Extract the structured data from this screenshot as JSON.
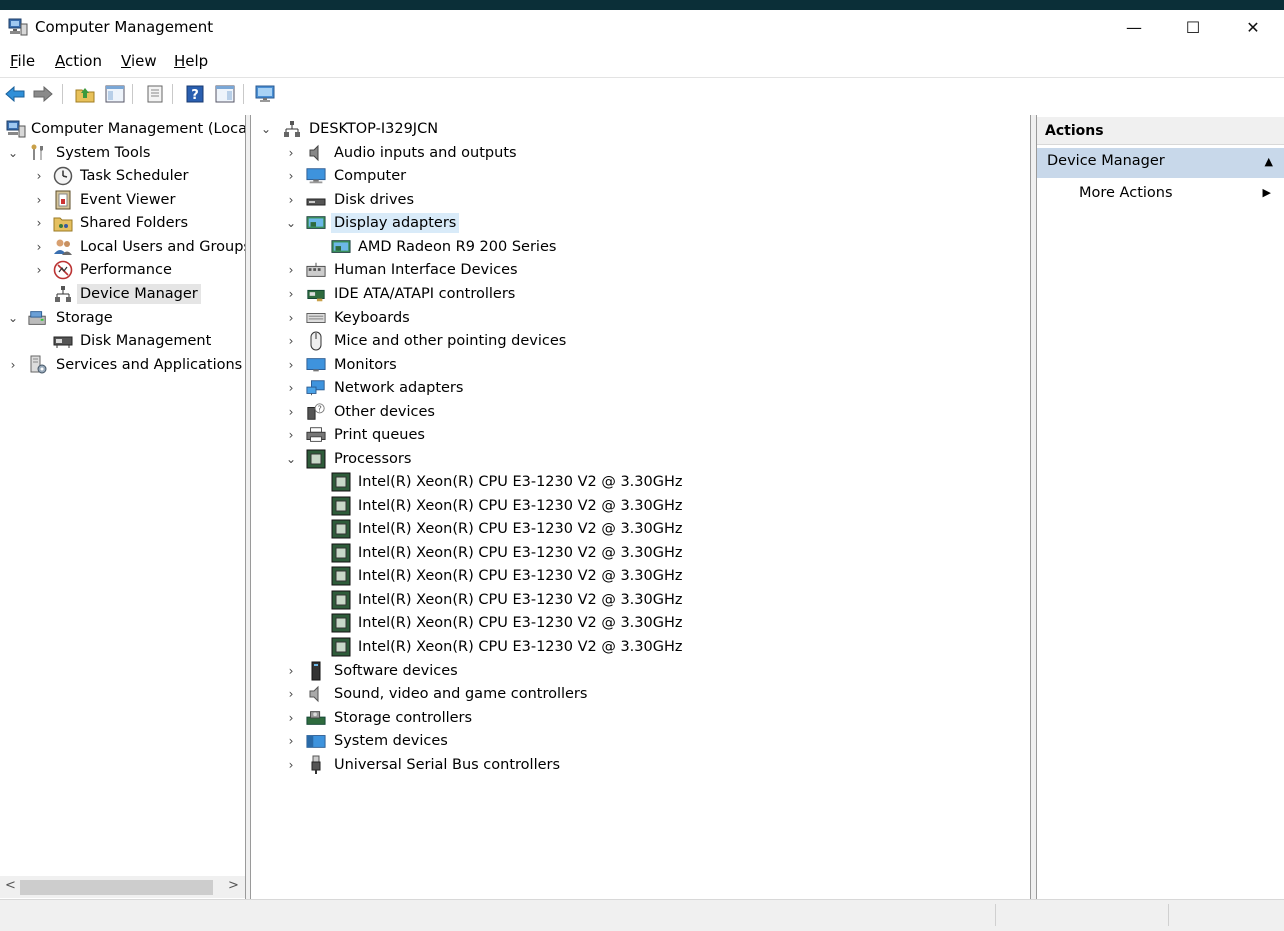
{
  "window": {
    "title": "Computer Management",
    "minimize": "—",
    "maximize": "☐",
    "close": "✕"
  },
  "menu": [
    {
      "label": "File",
      "key": "F",
      "rest": "ile"
    },
    {
      "label": "Action",
      "key": "A",
      "rest": "ction"
    },
    {
      "label": "View",
      "key": "V",
      "rest": "iew"
    },
    {
      "label": "Help",
      "key": "H",
      "rest": "elp"
    }
  ],
  "toolbar": [
    "back-icon",
    "forward-icon",
    "up-folder-icon",
    "show-hide-tree-icon",
    "properties-icon",
    "help-icon",
    "show-hide-action-pane-icon",
    "monitor-icon"
  ],
  "left_tree": {
    "root": "Computer Management (Local",
    "system_tools": "System Tools",
    "task_scheduler": "Task Scheduler",
    "event_viewer": "Event Viewer",
    "shared_folders": "Shared Folders",
    "local_users": "Local Users and Groups",
    "performance": "Performance",
    "device_manager": "Device Manager",
    "storage": "Storage",
    "disk_management": "Disk Management",
    "services": "Services and Applications"
  },
  "device_tree": {
    "computer_name": "DESKTOP-I329JCN",
    "audio": "Audio inputs and outputs",
    "computer": "Computer",
    "disk_drives": "Disk drives",
    "display_adapters": "Display adapters",
    "gpu": "AMD Radeon R9 200 Series",
    "hid": "Human Interface Devices",
    "ide": "IDE ATA/ATAPI controllers",
    "keyboards": "Keyboards",
    "mice": "Mice and other pointing devices",
    "monitors": "Monitors",
    "network": "Network adapters",
    "other": "Other devices",
    "print": "Print queues",
    "processors": "Processors",
    "cpus": [
      "Intel(R) Xeon(R) CPU E3-1230 V2 @ 3.30GHz",
      "Intel(R) Xeon(R) CPU E3-1230 V2 @ 3.30GHz",
      "Intel(R) Xeon(R) CPU E3-1230 V2 @ 3.30GHz",
      "Intel(R) Xeon(R) CPU E3-1230 V2 @ 3.30GHz",
      "Intel(R) Xeon(R) CPU E3-1230 V2 @ 3.30GHz",
      "Intel(R) Xeon(R) CPU E3-1230 V2 @ 3.30GHz",
      "Intel(R) Xeon(R) CPU E3-1230 V2 @ 3.30GHz",
      "Intel(R) Xeon(R) CPU E3-1230 V2 @ 3.30GHz"
    ],
    "software": "Software devices",
    "sound": "Sound, video and game controllers",
    "storage_ctrl": "Storage controllers",
    "system": "System devices",
    "usb": "Universal Serial Bus controllers"
  },
  "actions": {
    "header": "Actions",
    "section": "Device Manager",
    "more": "More Actions"
  },
  "colors": {
    "selection_blue": "#d9ebf9",
    "selection_grey": "#e5e5e5",
    "actions_section": "#c8d8ea",
    "top_band": "#0b2f38"
  }
}
